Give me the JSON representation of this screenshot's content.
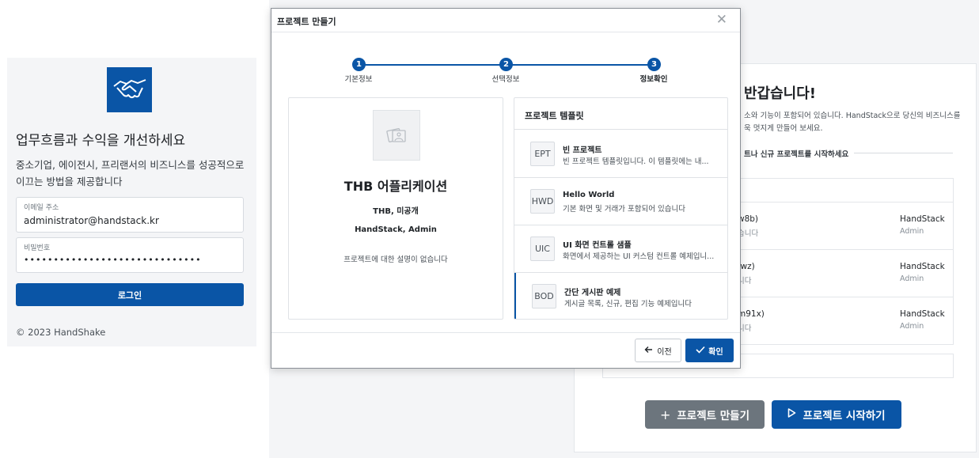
{
  "login": {
    "headline": "업무흐름과 수익을 개선하세요",
    "description": "중소기업, 에이전시, 프리랜서의 비즈니스를 성공적으로 이끄는 방법을 제공합니다",
    "email": {
      "label": "이메일 주소",
      "value": "administrator@handstack.kr"
    },
    "password": {
      "label": "비밀번호",
      "value": "••••••••••••••••••••••••••••••"
    },
    "login_button": "로그인",
    "copyright": "© 2023 HandShake",
    "logo_icon": "handshake-icon",
    "brand_color": "#0a55a6"
  },
  "background": {
    "welcome": "반갑습니다!",
    "intro": "소와 기능이 포함되어 있습니다. HandStack으로 당신의 비즈니스를 욱 멋지게 만들어 보세요.",
    "section": "트나 신규 프로젝트를 시작하세요",
    "rows": [
      {
        "name": "w8b)",
        "sub": "습니다",
        "org": "HandStack",
        "role": "Admin"
      },
      {
        "name": "fwz)",
        "sub": "니다",
        "org": "HandStack",
        "role": "Admin"
      },
      {
        "name": "m91x)",
        "sub": "니다",
        "org": "HandStack",
        "role": "Admin"
      }
    ],
    "create_button": "프로젝트 만들기",
    "start_button": "프로젝트 시작하기"
  },
  "modal": {
    "title": "프로젝트 만들기",
    "steps": [
      {
        "number": "1",
        "label": "기본정보"
      },
      {
        "number": "2",
        "label": "선택정보"
      },
      {
        "number": "3",
        "label": "정보확인"
      }
    ],
    "summary": {
      "project_name": "THB 어플리케이션",
      "meta1": "THB, 미공개",
      "meta2": "HandStack, Admin",
      "description": "프로젝트에 대한 설명이 없습니다"
    },
    "templates": {
      "header": "프로젝트 템플릿",
      "items": [
        {
          "code": "EPT",
          "name": "빈 프로젝트",
          "desc": "빈 프로젝트 템플릿입니다. 이 템플릿에는 내..."
        },
        {
          "code": "HWD",
          "name": "Hello World",
          "desc": "기본 화면 및 거래가 포함되어 있습니다"
        },
        {
          "code": "UIC",
          "name": "UI 화면 컨트롤 샘플",
          "desc": "화면에서 제공하는 UI 커스텀 컨트롤 예제입니..."
        },
        {
          "code": "BOD",
          "name": "간단 게시판 예제",
          "desc": "게시글 목록, 신규, 편집 기능 예제입니다"
        }
      ]
    },
    "prev_button": "이전",
    "confirm_button": "확인"
  }
}
